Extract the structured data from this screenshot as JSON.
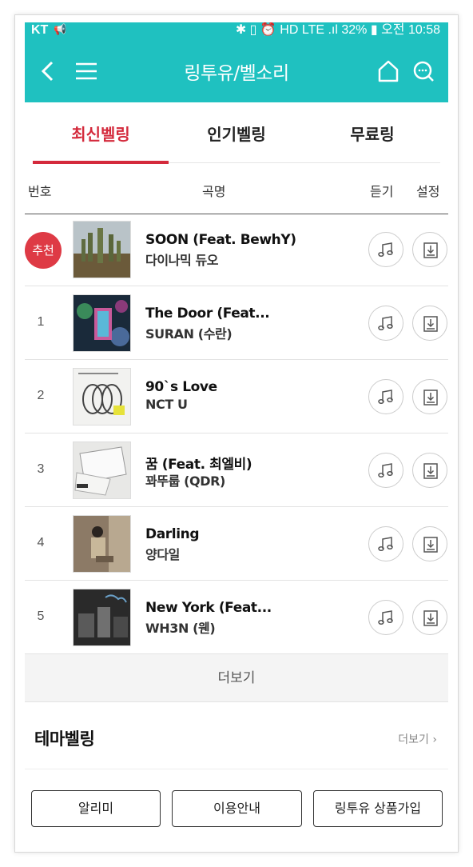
{
  "status": {
    "carrier": "KT",
    "right": "✱ ▯ ⏰ HD LTE .ıl 32% ▮ 오전 10:58"
  },
  "appbar": {
    "title": "링투유/벨소리"
  },
  "tabs": [
    "최신벨링",
    "인기벨링",
    "무료링"
  ],
  "columns": {
    "num": "번호",
    "title": "곡명",
    "listen": "듣기",
    "set": "설정"
  },
  "rows": [
    {
      "num": "추천",
      "title": "SOON (Feat. BewhY)",
      "artist": "다이나믹 듀오"
    },
    {
      "num": "1",
      "title": "The Door (Feat...",
      "artist": "SURAN (수란)"
    },
    {
      "num": "2",
      "title": "90`s Love",
      "artist": "NCT U"
    },
    {
      "num": "3",
      "title": "꿈 (Feat. 최엘비)",
      "artist": "꽈뚜룹 (QDR)"
    },
    {
      "num": "4",
      "title": "Darling",
      "artist": "양다일"
    },
    {
      "num": "5",
      "title": "New York (Feat...",
      "artist": "WH3N (웬)"
    }
  ],
  "more": "더보기",
  "theme": {
    "heading": "테마벨링",
    "more": "더보기 ›"
  },
  "buttons": [
    "알리미",
    "이용안내",
    "링투유 상품가입"
  ],
  "colors": {
    "accent": "#1fc1c0",
    "active": "#d42a3c",
    "badge": "#de3a45"
  }
}
